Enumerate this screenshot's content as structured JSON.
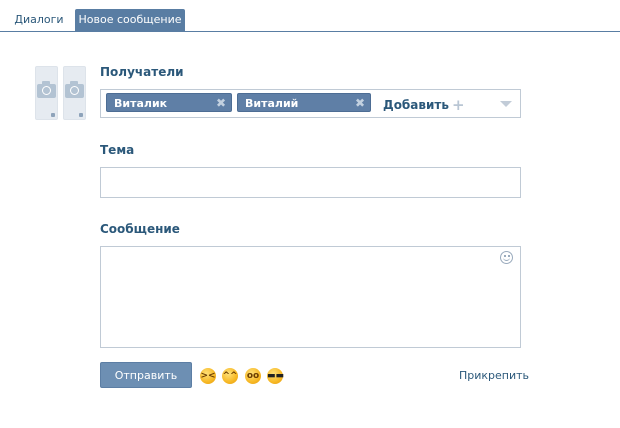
{
  "tabs": [
    {
      "label": "Диалоги",
      "active": false
    },
    {
      "label": "Новое сообщение",
      "active": true
    }
  ],
  "recipients": {
    "label": "Получатели",
    "chips": [
      {
        "name": "Виталик"
      },
      {
        "name": "Виталий"
      }
    ],
    "add_label": "Добавить"
  },
  "subject": {
    "label": "Тема",
    "value": ""
  },
  "message": {
    "label": "Сообщение",
    "value": ""
  },
  "actions": {
    "send_label": "Отправить",
    "attach_label": "Прикрепить"
  },
  "emoji": [
    "laughing-emoji",
    "smile-emoji",
    "surprised-emoji",
    "cool-emoji"
  ],
  "colors": {
    "accent": "#597da3",
    "chip": "#5f7fa6",
    "button": "#6d8fb3",
    "label": "#2b587a"
  }
}
